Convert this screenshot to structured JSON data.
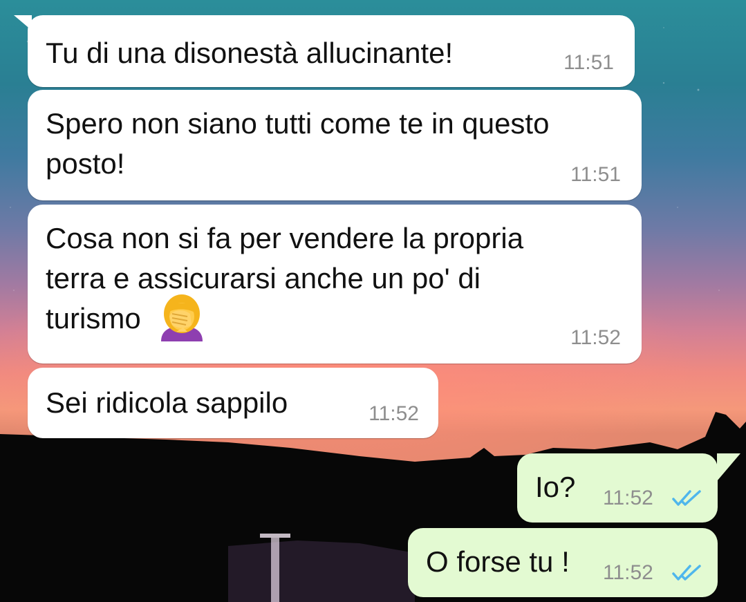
{
  "messages": [
    {
      "direction": "incoming",
      "text": "Tu di una disonestà allucinante!",
      "time": "11:51"
    },
    {
      "direction": "incoming",
      "text_line1": "Spero non siano tutti come te in questo",
      "text_line2": "posto!",
      "time": "11:51"
    },
    {
      "direction": "incoming",
      "text_line1": "Cosa non si fa per vendere la propria",
      "text_line2": "terra e assicurarsi anche un po' di",
      "text_line3": "turismo",
      "emoji": "woman-facepalming-icon",
      "time": "11:52"
    },
    {
      "direction": "incoming",
      "text": "Sei ridicola sappilo",
      "time": "11:52"
    },
    {
      "direction": "outgoing",
      "text": "Io?",
      "time": "11:52",
      "status": "read"
    },
    {
      "direction": "outgoing",
      "text": "O forse tu !",
      "time": "11:52",
      "status": "read"
    }
  ],
  "colors": {
    "incoming_bubble": "#ffffff",
    "outgoing_bubble": "#e3fad2",
    "timestamp": "#8e8e8e",
    "read_ticks": "#4fb6ec"
  }
}
